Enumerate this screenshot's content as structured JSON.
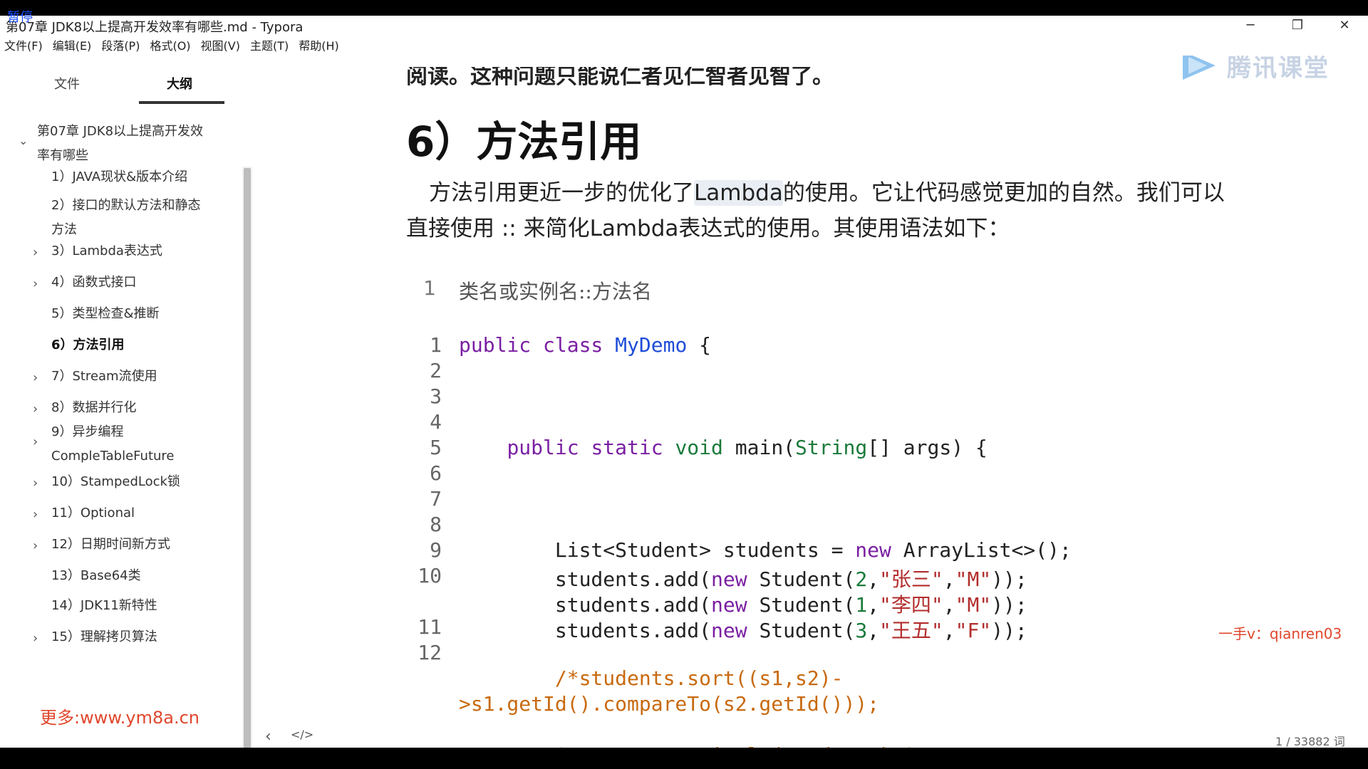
{
  "window": {
    "title": "第07章 JDK8以上提高开发效率有哪些.md - Typora",
    "watermark_top": "暂停"
  },
  "menu": [
    "文件(F)",
    "编辑(E)",
    "段落(P)",
    "格式(O)",
    "视图(V)",
    "主题(T)",
    "帮助(H)"
  ],
  "sidebar": {
    "tabs": [
      "文件",
      "大纲"
    ],
    "outline": [
      {
        "label": "第07章 JDK8以上提高开发效",
        "label2": "率有哪些",
        "level": 0,
        "arrow": "⌄"
      },
      {
        "label": "1）JAVA现状&版本介绍",
        "level": 1,
        "arrow": ""
      },
      {
        "label": "2）接口的默认方法和静态",
        "label2": "方法",
        "level": 1,
        "arrow": ""
      },
      {
        "label": "3）Lambda表达式",
        "level": 1,
        "arrow": "›"
      },
      {
        "label": "4）函数式接口",
        "level": 1,
        "arrow": "›"
      },
      {
        "label": "5）类型检查&推断",
        "level": 1,
        "arrow": ""
      },
      {
        "label": "6）方法引用",
        "level": 1,
        "arrow": "",
        "active": true
      },
      {
        "label": "7）Stream流使用",
        "level": 1,
        "arrow": "›"
      },
      {
        "label": "8）数据并行化",
        "level": 1,
        "arrow": "›"
      },
      {
        "label": "9）异步编程",
        "label2": "CompleTableFuture",
        "level": 1,
        "arrow": "›"
      },
      {
        "label": "10）StampedLock锁",
        "level": 1,
        "arrow": "›"
      },
      {
        "label": "11）Optional",
        "level": 1,
        "arrow": "›"
      },
      {
        "label": "12）日期时间新方式",
        "level": 1,
        "arrow": "›"
      },
      {
        "label": "13）Base64类",
        "level": 1,
        "arrow": ""
      },
      {
        "label": "14）JDK11新特性",
        "level": 1,
        "arrow": ""
      },
      {
        "label": "15）理解拷贝算法",
        "level": 1,
        "arrow": "›"
      }
    ],
    "footer_left": "‹",
    "footer_right": "</>",
    "watermark": "更多:www.ym8a.cn"
  },
  "editor": {
    "cut_text": "阅读。这种问题只能说仁者见仁智者见智了。",
    "heading": "6）方法引用",
    "para_before": "方法引用更近一步的优化了",
    "para_highlight": "Lambda",
    "para_after": "的使用。它让代码感觉更加的自然。我们可以直接使用 :: 来简化Lambda表达式的使用。其使用语法如下：",
    "syntax_line_no": "1",
    "syntax_line": "类名或实例名::方法名",
    "code_line_numbers": [
      "1",
      "2",
      "3",
      "4",
      "5",
      "6",
      "7",
      "8",
      "9",
      "10",
      "",
      "11",
      "12"
    ],
    "logo_text": "腾讯课堂",
    "watermark_right": "一手v：qianren03",
    "word_count": "1 / 33882 词"
  },
  "colors": {
    "keyword": "#7a1fa2",
    "class": "#1e4dd8",
    "type": "#1a7a3a",
    "string": "#b32d2d",
    "comment": "#c86a10"
  }
}
